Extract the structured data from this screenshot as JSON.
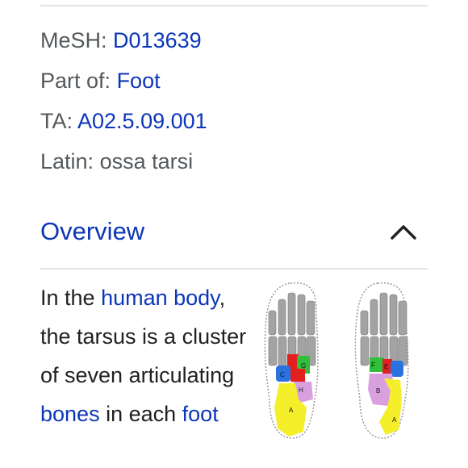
{
  "infobox": {
    "rows": [
      {
        "label": "MeSH:",
        "value": "D013639",
        "is_link": true
      },
      {
        "label": "Part of:",
        "value": "Foot",
        "is_link": true
      },
      {
        "label": "TA:",
        "value": "A02.5.09.001",
        "is_link": true
      },
      {
        "label": "Latin:",
        "value": "ossa tarsi",
        "is_link": false
      }
    ]
  },
  "section": {
    "title": "Overview",
    "toggle_icon": "chevron-up-icon"
  },
  "paragraph": {
    "t1": "In the ",
    "l1": "human body",
    "t2": ", the tarsus is a cluster of seven articulating ",
    "l2": "bones",
    "t3": " in each ",
    "l3": "foot"
  },
  "figure": {
    "labels": {
      "a": "A",
      "b": "B",
      "c": "C",
      "e": "E",
      "f": "F",
      "g": "G",
      "h": "H"
    }
  },
  "colors": {
    "link": "#0b36b8",
    "label_gray": "#54595d",
    "body_text": "#202122",
    "divider": "#e1e3e6",
    "bone_gray": "#a3a3a3",
    "talus": "#f5ee2a",
    "calcaneus": "#f5ee2a",
    "navicular": "#d9a0e0",
    "cuboid": "#2a72e0",
    "cuneiform_red": "#e32020",
    "cuneiform_green": "#2fbf3a"
  }
}
